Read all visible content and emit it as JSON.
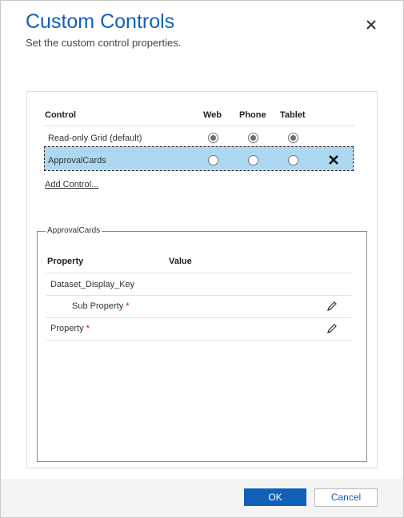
{
  "dialog": {
    "title": "Custom Controls",
    "subtitle": "Set the custom control properties.",
    "close_icon": "close-icon"
  },
  "controls_table": {
    "headers": {
      "control": "Control",
      "web": "Web",
      "phone": "Phone",
      "tablet": "Tablet"
    },
    "rows": [
      {
        "name": "Read-only Grid (default)",
        "web": true,
        "phone": true,
        "tablet": true
      },
      {
        "name": "ApprovalCards",
        "web": false,
        "phone": false,
        "tablet": false,
        "selected": true
      }
    ],
    "remove_icon": "x-remove-icon"
  },
  "add_control_label": "Add Control...",
  "properties": {
    "legend": "ApprovalCards",
    "headers": {
      "property": "Property",
      "value": "Value"
    },
    "rows": [
      {
        "label": "Dataset_Display_Key"
      },
      {
        "label": "Sub Property",
        "required": "*",
        "edit_icon": "pencil-icon"
      },
      {
        "label": "Property",
        "required": "*",
        "edit_icon": "pencil-icon"
      }
    ]
  },
  "footer": {
    "ok_label": "OK",
    "cancel_label": "Cancel"
  },
  "colors": {
    "accent": "#1160b7",
    "selected_row": "#add8f2",
    "required": "#cc0000"
  }
}
